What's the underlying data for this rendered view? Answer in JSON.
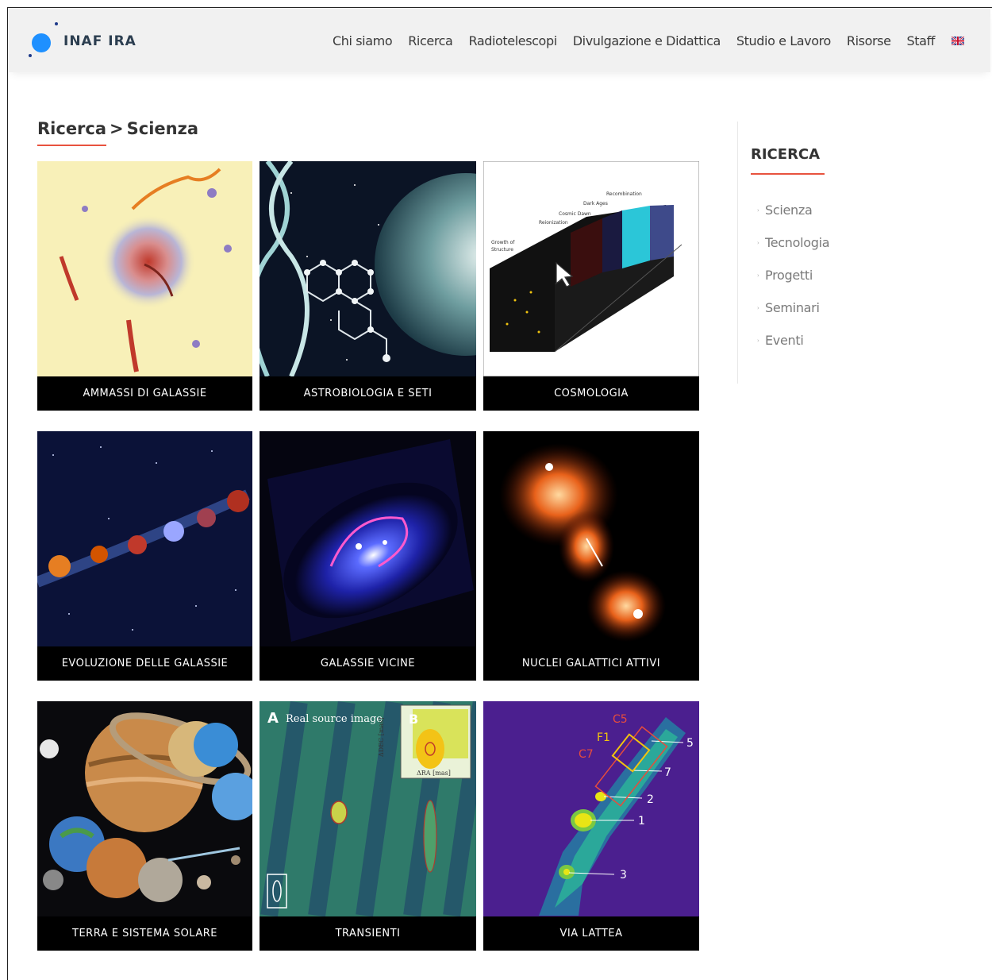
{
  "header": {
    "logo_text": "INAF IRA",
    "nav": [
      "Chi siamo",
      "Ricerca",
      "Radiotelescopi",
      "Divulgazione e Didattica",
      "Studio e Lavoro",
      "Risorse",
      "Staff"
    ]
  },
  "breadcrumb": {
    "parent": "Ricerca",
    "separator": ">",
    "current": "Scienza"
  },
  "tiles": [
    {
      "label": "AMMASSI DI GALASSIE"
    },
    {
      "label": "ASTROBIOLOGIA E SETI"
    },
    {
      "label": "COSMOLOGIA"
    },
    {
      "label": "EVOLUZIONE DELLE GALASSIE"
    },
    {
      "label": "GALASSIE VICINE"
    },
    {
      "label": "NUCLEI GALATTICI ATTIVI"
    },
    {
      "label": "TERRA E SISTEMA SOLARE"
    },
    {
      "label": "TRANSIENTI"
    },
    {
      "label": "VIA LATTEA"
    }
  ],
  "figure_text": {
    "cosmo": {
      "recombination": "Recombination",
      "dark_ages": "Dark Ages",
      "cosmic_dawn": "Cosmic Dawn",
      "reionization": "Reionization",
      "growth_1": "Growth of",
      "growth_2": "Structure"
    },
    "transient": {
      "panel_a": "A",
      "real_source": "Real source image",
      "panel_b": "B",
      "dec_label": "ΔDEC [mas]",
      "ra_label": "ΔRA [mas]"
    },
    "milkyway": {
      "c5": "C5",
      "f1": "F1",
      "c7": "C7",
      "n5": "5",
      "n7": "7",
      "n2": "2",
      "n1": "1",
      "n3": "3"
    }
  },
  "sidebar": {
    "title": "RICERCA",
    "items": [
      "Scienza",
      "Tecnologia",
      "Progetti",
      "Seminari",
      "Eventi"
    ]
  },
  "colors": {
    "accent": "#e8533f",
    "header_bg": "#f1f1f1",
    "tile_label_bg": "#000000"
  }
}
